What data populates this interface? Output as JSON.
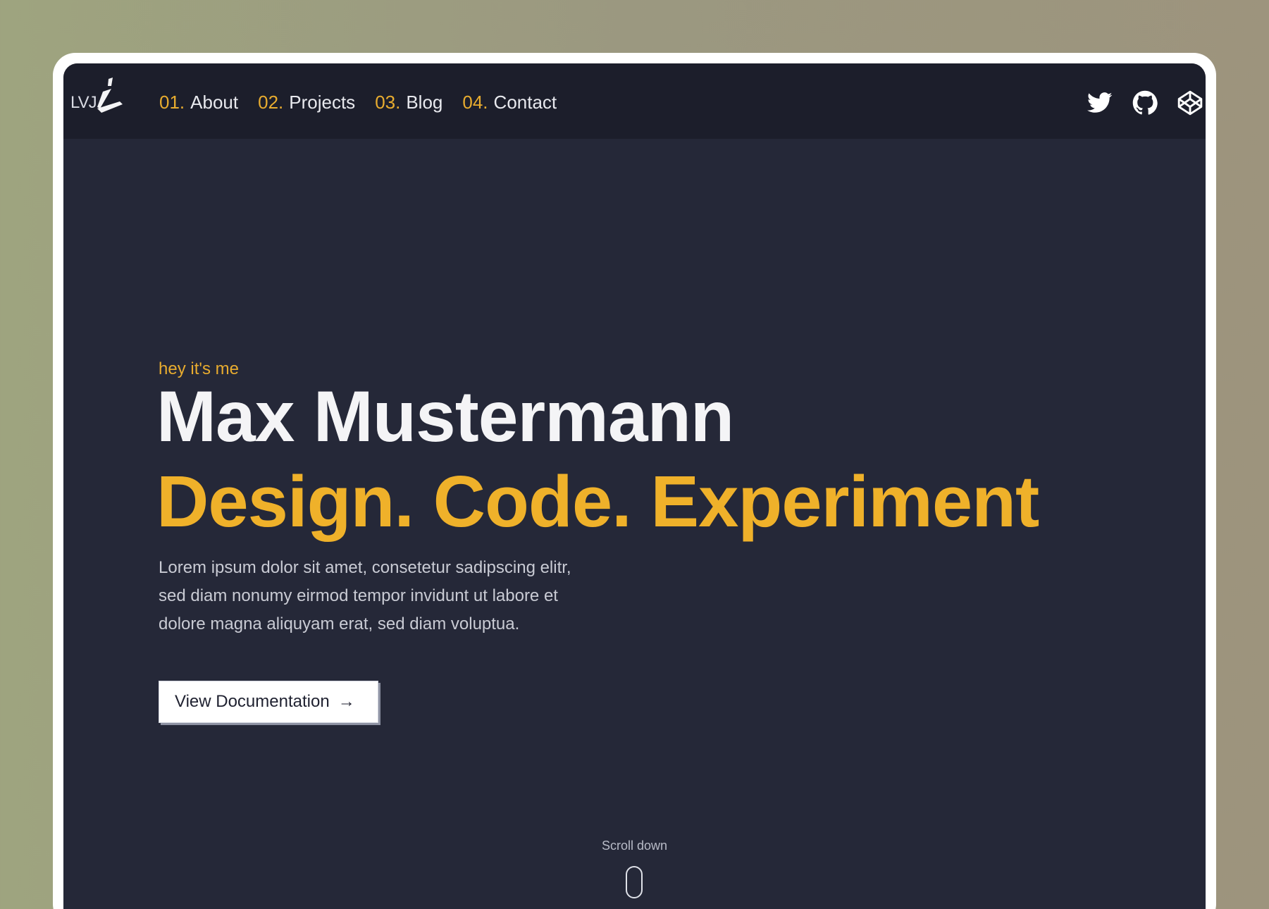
{
  "brand": {
    "logo_text": "LVJ"
  },
  "nav": {
    "items": [
      {
        "num": "01.",
        "label": "About"
      },
      {
        "num": "02.",
        "label": "Projects"
      },
      {
        "num": "03.",
        "label": "Blog"
      },
      {
        "num": "04.",
        "label": "Contact"
      }
    ]
  },
  "socials": {
    "icons": [
      "twitter-icon",
      "github-icon",
      "codepen-icon"
    ]
  },
  "hero": {
    "kicker": "hey it's me",
    "name": "Max Mustermann",
    "tagline": "Design. Code. Experiment",
    "lead_lines": [
      "Lorem ipsum dolor sit amet, consetetur sadipscing elitr,",
      "sed diam nonumy eirmod tempor invidunt ut labore et",
      "dolore magna aliquyam erat, sed diam voluptua."
    ],
    "button_label": "View Documentation",
    "button_icon": "arrow-right-icon"
  },
  "scroll": {
    "label": "Scroll down",
    "icon": "mouse-icon"
  },
  "colors": {
    "accent": "#efb12a",
    "background": "#252838",
    "navbar": "#1c1e2b",
    "outer": "#9e9c7f"
  }
}
